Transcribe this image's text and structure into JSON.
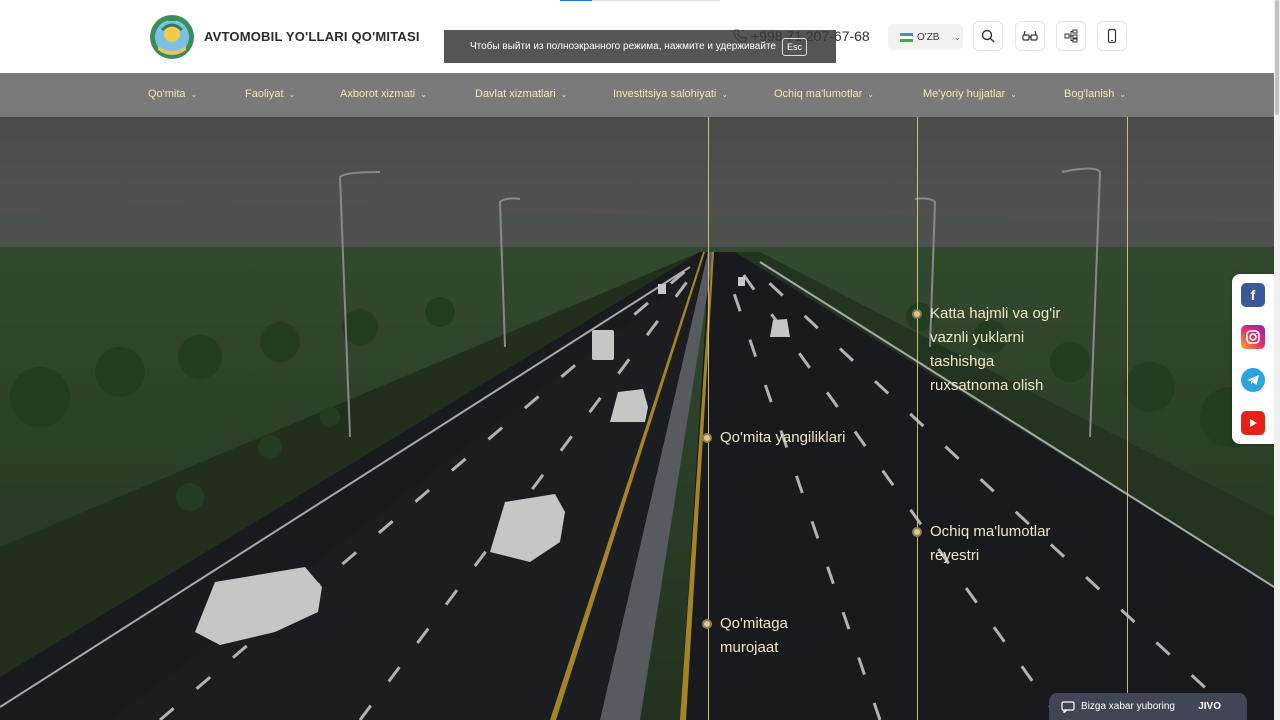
{
  "header": {
    "brand": "AVTOMOBIL YO'LLARI QO'MITASI",
    "phone": "+998 71 207-67-68",
    "lang": "O'ZB",
    "icons": [
      "search-icon",
      "glasses-icon",
      "sitemap-icon",
      "mobile-icon"
    ]
  },
  "toast": {
    "text": "Чтобы выйти из полноэкранного режима, нажмите и удерживайте",
    "key": "Esc"
  },
  "nav": {
    "items": [
      "Qo'mita",
      "Faoliyat",
      "Axborot xizmati",
      "Davlat xizmatlari",
      "Investitsiya salohiyati",
      "Ochiq ma'lumotlar",
      "Me'yoriy hujjatlar",
      "Bog'lanish"
    ]
  },
  "hero": {
    "links": [
      "Katta hajmli va og'ir vaznli yuklarni tashishga ruxsatnoma olish",
      "Qo'mita yangiliklari",
      "Ochiq ma'lumotlar reyestri",
      "Qo'mitaga murojaat"
    ]
  },
  "social": [
    "facebook-icon",
    "instagram-icon",
    "telegram-icon",
    "youtube-icon"
  ],
  "chat": {
    "label": "Bizga xabar yuboring",
    "brand": "JIVO"
  },
  "colors": {
    "nav_bg": "#7a7a7a",
    "nav_text": "#f3e6b0",
    "accent_gold": "#d9c98a",
    "chat_bg": "#404654"
  }
}
